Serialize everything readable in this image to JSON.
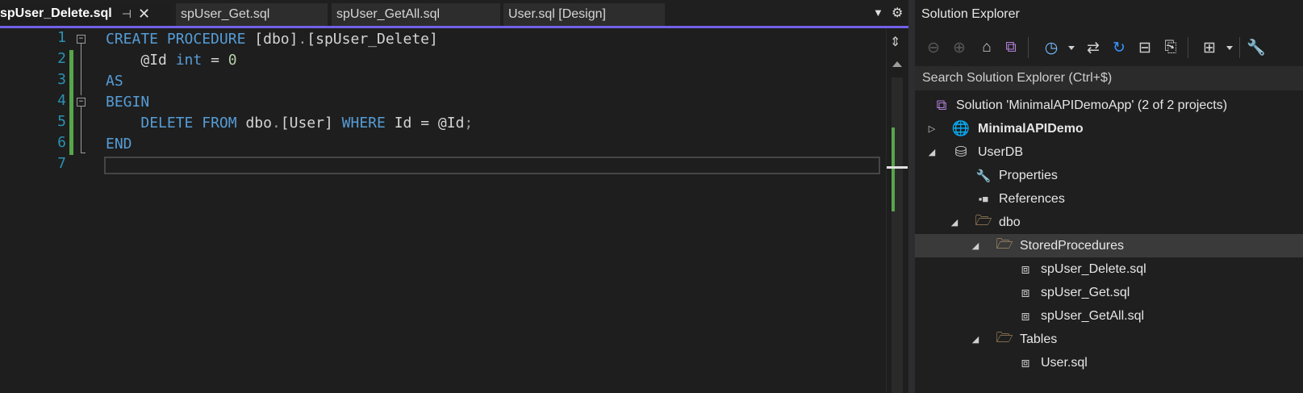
{
  "tabs": [
    {
      "label": "spUser_Delete.sql",
      "active": true
    },
    {
      "label": "spUser_Get.sql",
      "active": false
    },
    {
      "label": "spUser_GetAll.sql",
      "active": false
    },
    {
      "label": "User.sql [Design]",
      "active": false
    }
  ],
  "tab_icons": {
    "pin": "pin-icon",
    "close": "close-icon",
    "overflow": "chevron-down-icon",
    "settings": "gear-icon"
  },
  "editor": {
    "line_numbers": [
      "1",
      "2",
      "3",
      "4",
      "5",
      "6",
      "7"
    ],
    "code": {
      "l1_create": "CREATE",
      "l1_procedure": "PROCEDURE",
      "l1_schema": "[dbo]",
      "l1_dot": ".",
      "l1_name": "[spUser_Delete]",
      "l2_param": "@Id",
      "l2_type": "int",
      "l2_eq": "=",
      "l2_default": "0",
      "l3_as": "AS",
      "l4_begin": "BEGIN",
      "l5_delete": "DELETE",
      "l5_from": "FROM",
      "l5_schema": "dbo",
      "l5_dot": ".",
      "l5_table": "[User]",
      "l5_where": "WHERE",
      "l5_col": "Id",
      "l5_eq": "=",
      "l5_param": "@Id",
      "l5_semi": ";",
      "l6_end": "END"
    },
    "syntax_colors": {
      "keyword": "#569cd6",
      "identifier": "#d4d4d4",
      "number": "#b5cea8",
      "line_number": "#2b91af",
      "change_bar": "#57a64a"
    }
  },
  "solution_explorer": {
    "title": "Solution Explorer",
    "search_placeholder": "Search Solution Explorer (Ctrl+$)",
    "tree": [
      {
        "label": "Solution 'MinimalAPIDemoApp' (2 of 2 projects)",
        "icon": "solution-icon",
        "expander": ""
      },
      {
        "label": "MinimalAPIDemo",
        "icon": "web-project-icon",
        "expander": "collapsed",
        "bold": true
      },
      {
        "label": "UserDB",
        "icon": "database-project-icon",
        "expander": "expanded"
      },
      {
        "label": "Properties",
        "icon": "wrench-icon",
        "expander": ""
      },
      {
        "label": "References",
        "icon": "references-icon",
        "expander": ""
      },
      {
        "label": "dbo",
        "icon": "folder-open-icon",
        "expander": "expanded"
      },
      {
        "label": "StoredProcedures",
        "icon": "folder-open-icon",
        "expander": "expanded",
        "selected": true
      },
      {
        "label": "spUser_Delete.sql",
        "icon": "sql-file-icon",
        "expander": ""
      },
      {
        "label": "spUser_Get.sql",
        "icon": "sql-file-icon",
        "expander": ""
      },
      {
        "label": "spUser_GetAll.sql",
        "icon": "sql-file-icon",
        "expander": ""
      },
      {
        "label": "Tables",
        "icon": "folder-open-icon",
        "expander": "expanded"
      },
      {
        "label": "User.sql",
        "icon": "sql-file-icon",
        "expander": ""
      }
    ]
  },
  "colors": {
    "accent": "#7160e8",
    "background": "#1e1e1e",
    "folder": "#dcb67a"
  }
}
